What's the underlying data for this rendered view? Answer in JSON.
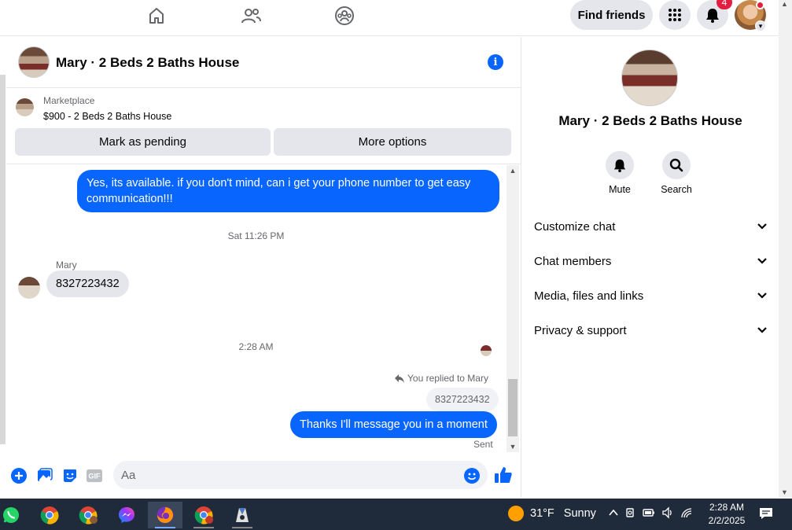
{
  "topbar": {
    "find_friends": "Find friends",
    "notification_count": "4",
    "icons": [
      "home-icon",
      "friends-icon",
      "groups-icon",
      "menu-grid-icon",
      "bell-icon"
    ]
  },
  "chat": {
    "title": "Mary · 2 Beds 2 Baths House",
    "marketplace_label": "Marketplace",
    "listing": "$900 - 2 Beds 2 Baths House",
    "mark_pending": "Mark as pending",
    "more_options": "More options",
    "messages": {
      "out1": "Yes, its available. if you don't mind, can i get your phone number to get easy communication!!!",
      "time1": "Sat 11:26 PM",
      "sender": "Mary",
      "in1": "8327223432",
      "time2": "2:28 AM",
      "reply_label": "You replied to Mary",
      "reply_quote": "8327223432",
      "out2": "Thanks I'll message you in a moment",
      "status": "Sent"
    },
    "composer_placeholder": "Aa"
  },
  "info_panel": {
    "title": "Mary · 2 Beds 2 Baths House",
    "mute": "Mute",
    "search": "Search",
    "sections": [
      "Customize chat",
      "Chat members",
      "Media, files and links",
      "Privacy & support"
    ]
  },
  "taskbar": {
    "weather_temp": "31°F",
    "weather_text": "Sunny",
    "time": "2:28 AM",
    "date": "2/2/2025"
  },
  "colors": {
    "accent": "#0866ff",
    "taskbar": "#1f2a3a",
    "badge": "#e41e3f"
  }
}
